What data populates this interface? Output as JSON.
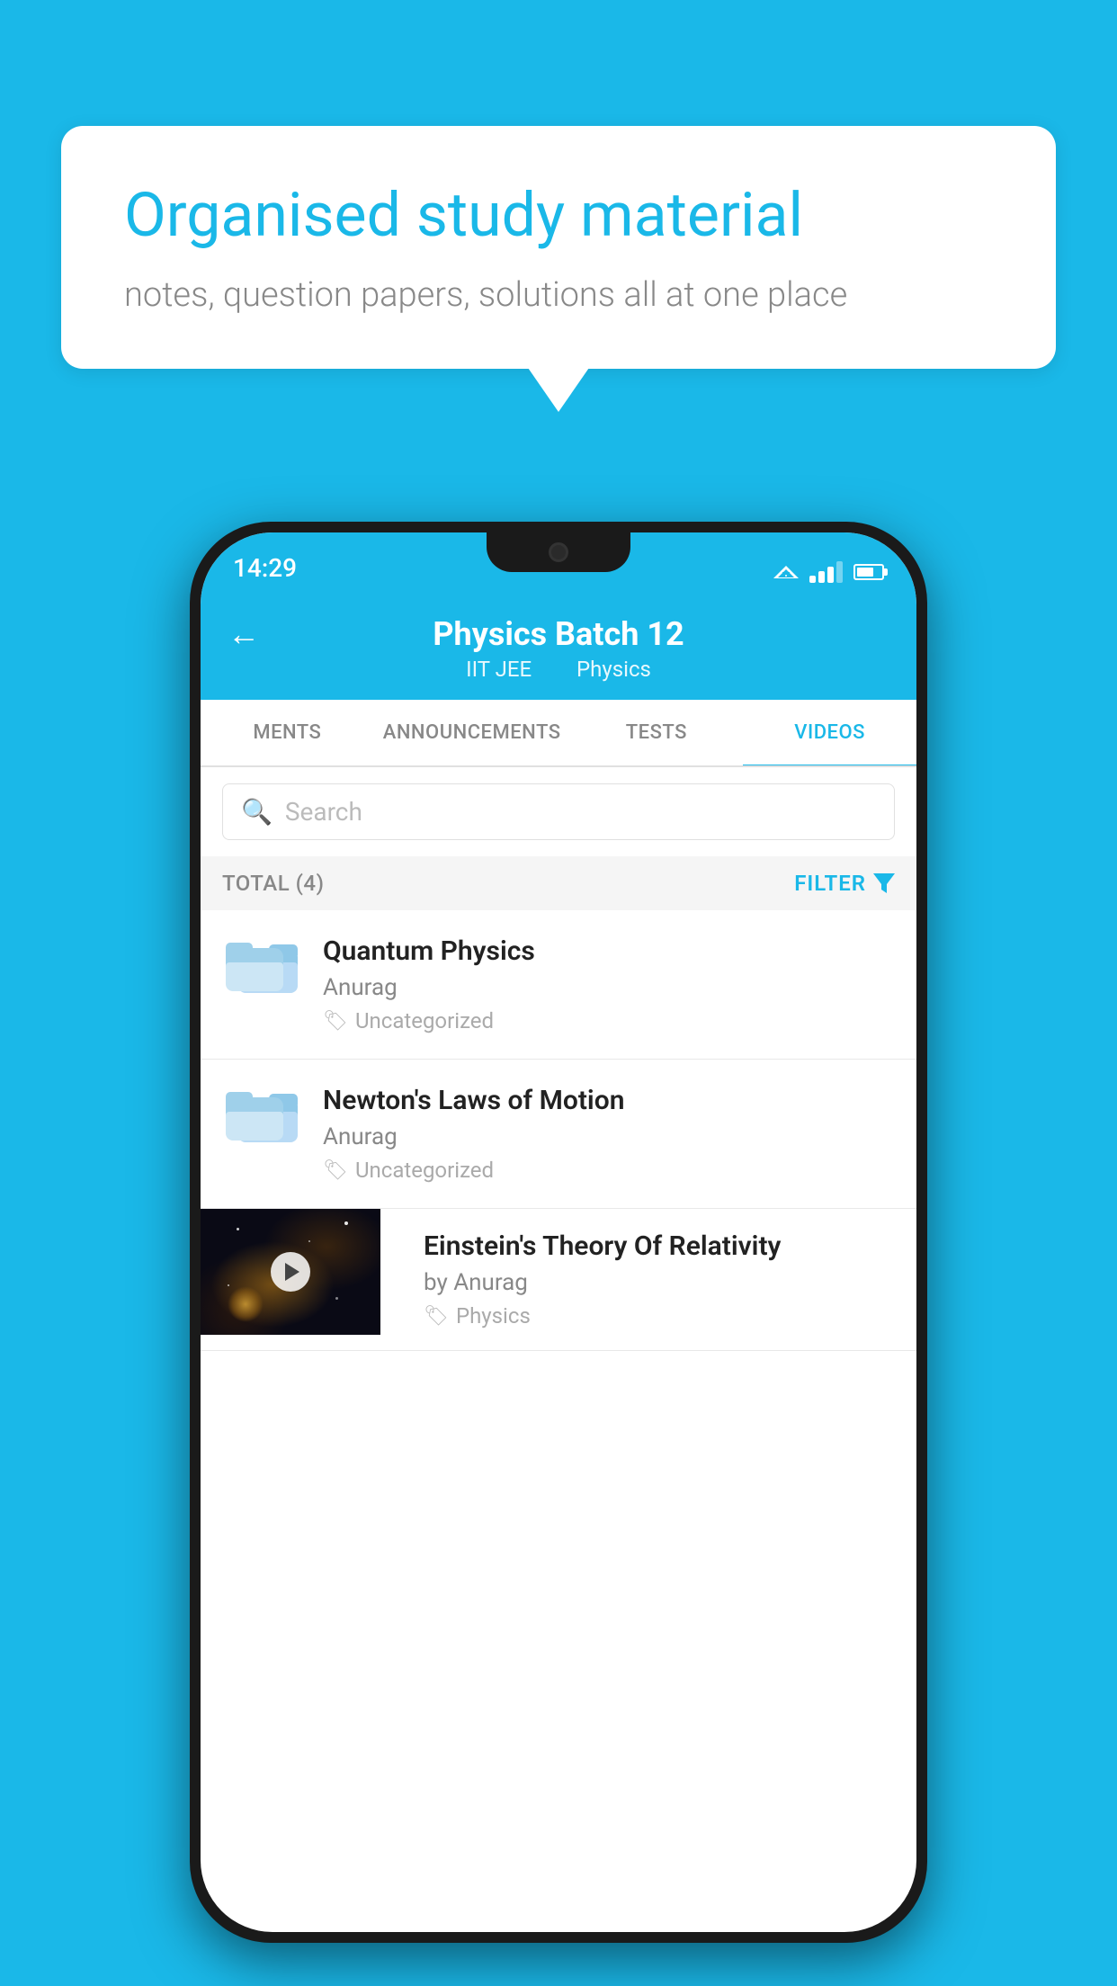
{
  "background_color": "#1ab8e8",
  "speech_bubble": {
    "heading": "Organised study material",
    "subtext": "notes, question papers, solutions all at one place"
  },
  "phone": {
    "status_bar": {
      "time": "14:29"
    },
    "header": {
      "back_label": "←",
      "title": "Physics Batch 12",
      "subtitle_part1": "IIT JEE",
      "subtitle_part2": "Physics"
    },
    "tabs": [
      {
        "label": "MENTS",
        "active": false
      },
      {
        "label": "ANNOUNCEMENTS",
        "active": false
      },
      {
        "label": "TESTS",
        "active": false
      },
      {
        "label": "VIDEOS",
        "active": true
      }
    ],
    "search": {
      "placeholder": "Search"
    },
    "filter_bar": {
      "total_label": "TOTAL (4)",
      "filter_label": "FILTER"
    },
    "videos": [
      {
        "title": "Quantum Physics",
        "author": "Anurag",
        "tag": "Uncategorized",
        "has_thumbnail": false
      },
      {
        "title": "Newton's Laws of Motion",
        "author": "Anurag",
        "tag": "Uncategorized",
        "has_thumbnail": false
      },
      {
        "title": "Einstein's Theory Of Relativity",
        "author": "by Anurag",
        "tag": "Physics",
        "has_thumbnail": true
      }
    ]
  }
}
